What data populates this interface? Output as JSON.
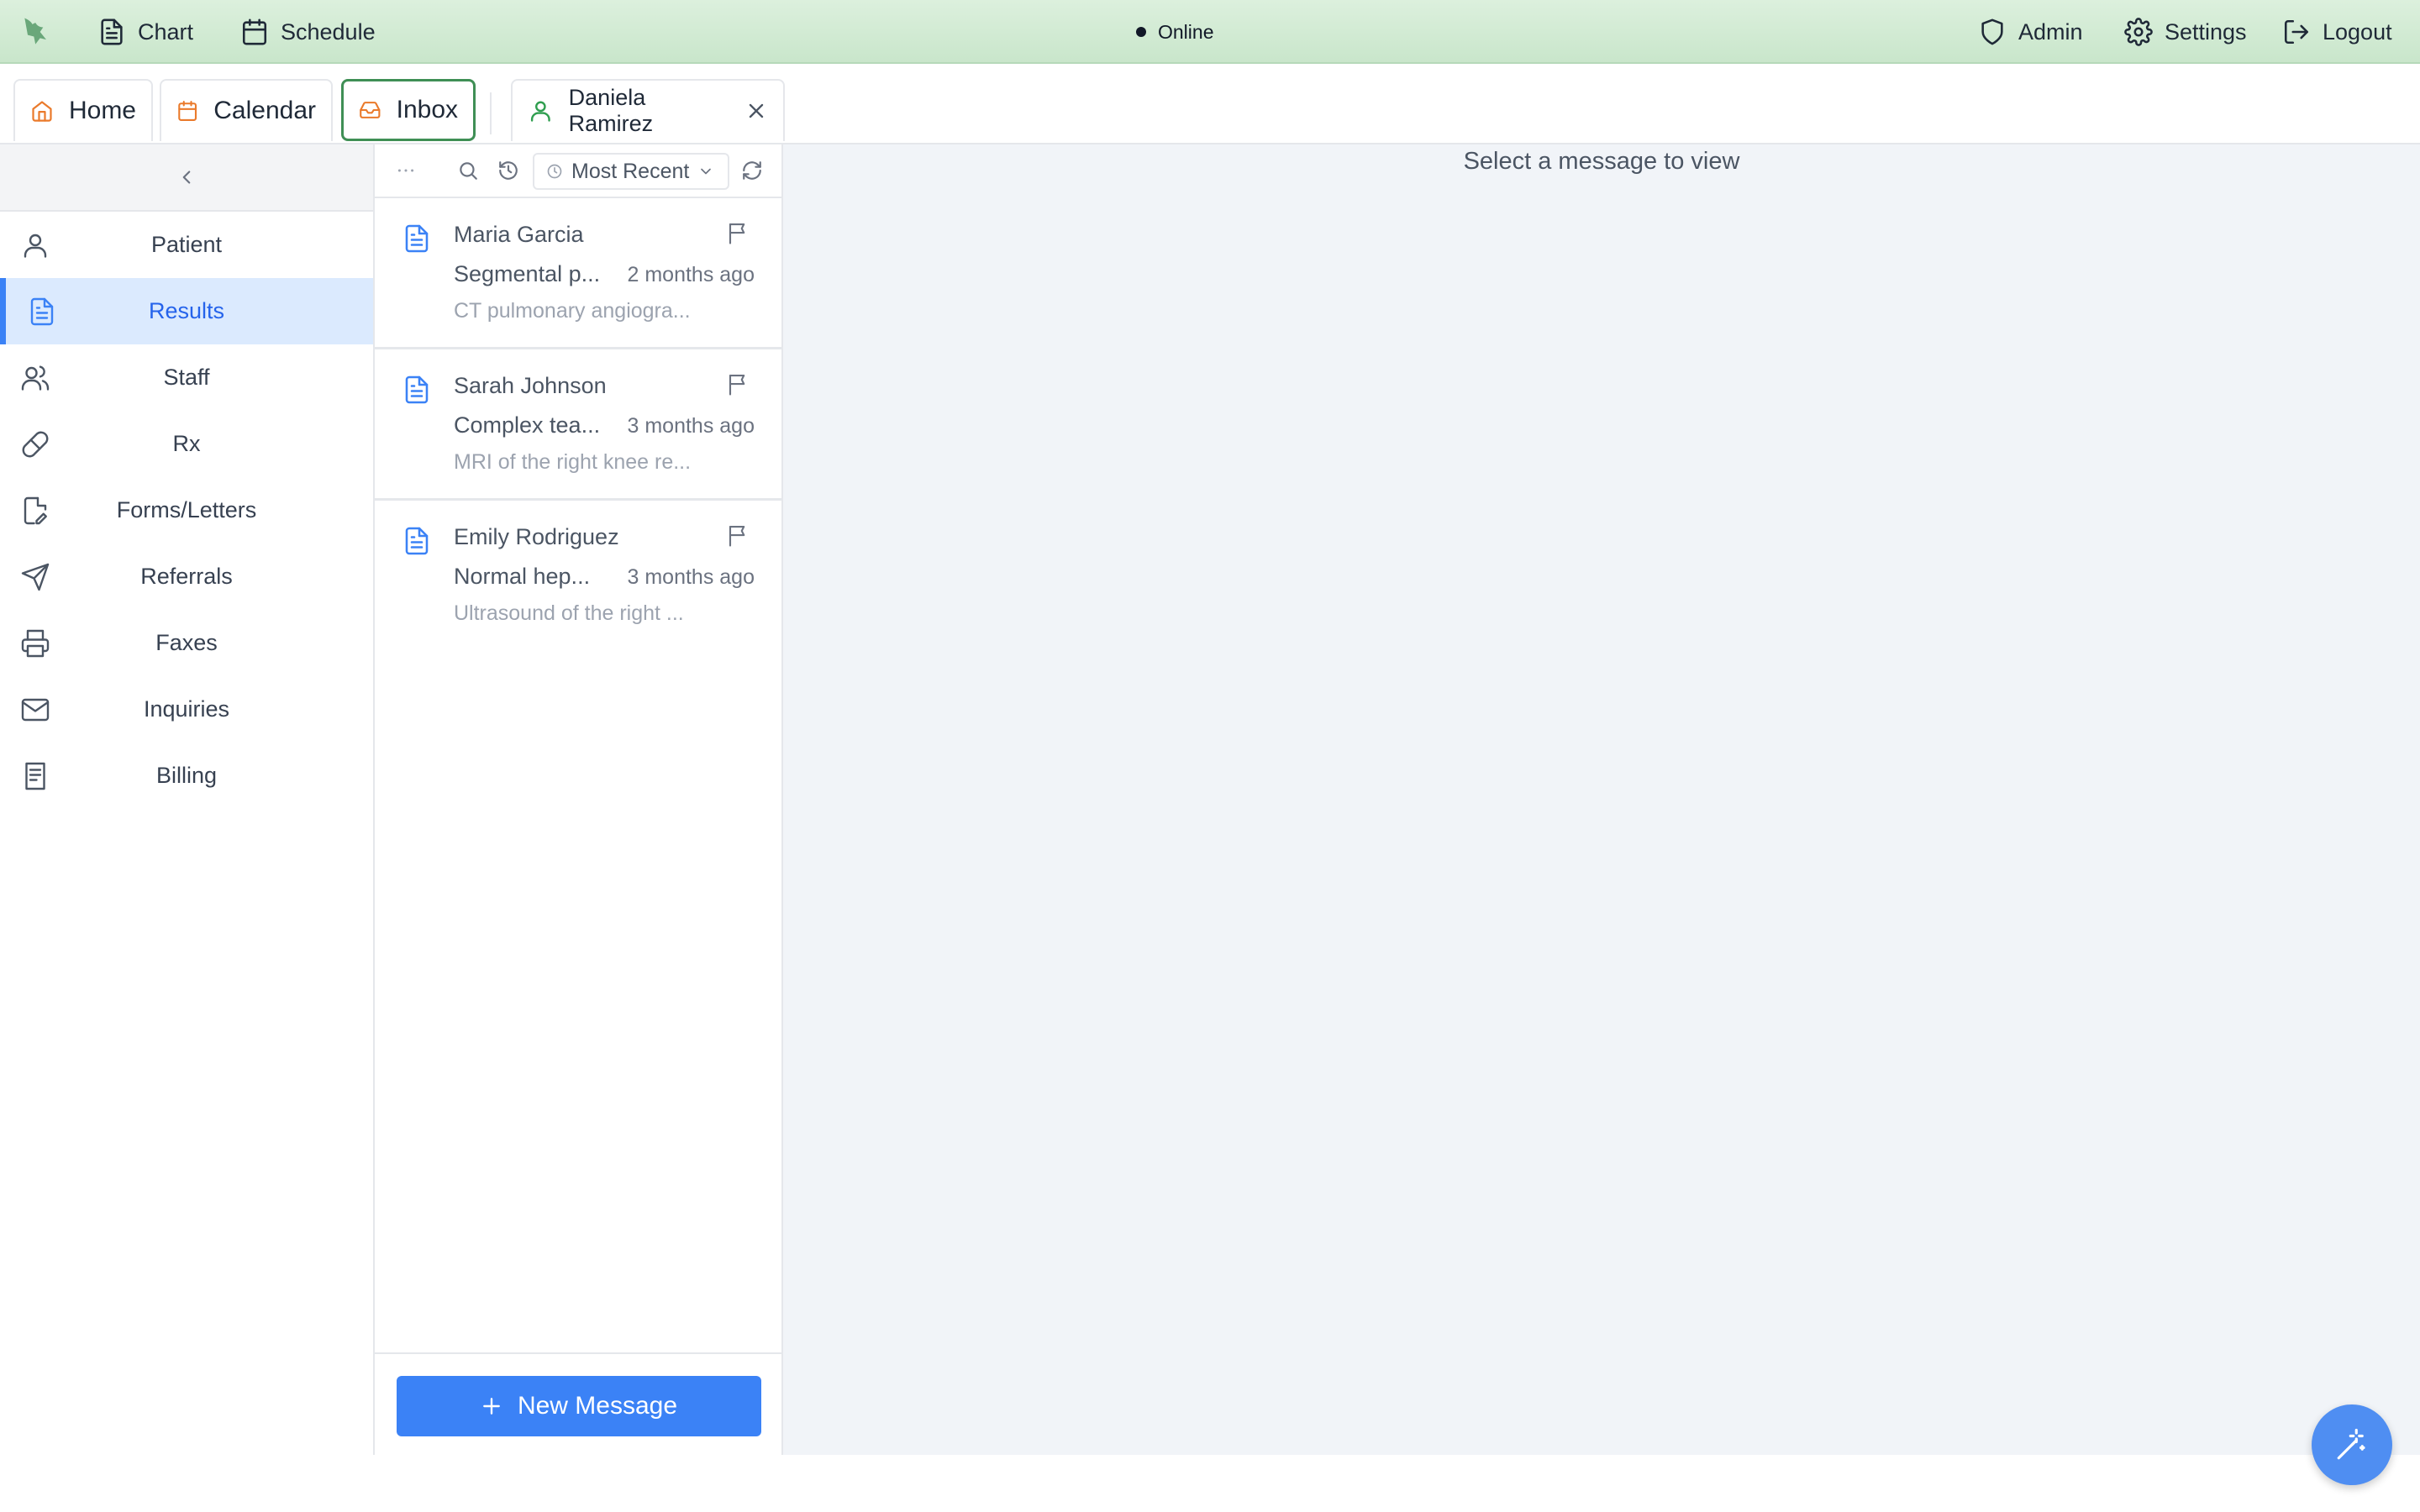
{
  "topbar": {
    "nav": [
      {
        "label": "Chart",
        "icon": "file-text-icon"
      },
      {
        "label": "Schedule",
        "icon": "calendar-icon"
      }
    ],
    "status": "Online",
    "right": [
      {
        "label": "Admin",
        "icon": "shield-icon"
      },
      {
        "label": "Settings",
        "icon": "gear-icon"
      },
      {
        "label": "Logout",
        "icon": "logout-icon"
      }
    ]
  },
  "tabs": [
    {
      "label": "Home",
      "icon": "home-icon",
      "active": false
    },
    {
      "label": "Calendar",
      "icon": "calendar-icon",
      "active": false
    },
    {
      "label": "Inbox",
      "icon": "inbox-icon",
      "active": true
    }
  ],
  "patient_tab": {
    "label": "Daniela Ramirez",
    "icon": "user-icon"
  },
  "sidebar": {
    "items": [
      {
        "label": "Patient",
        "icon": "user-icon",
        "active": false
      },
      {
        "label": "Results",
        "icon": "document-icon",
        "active": true
      },
      {
        "label": "Staff",
        "icon": "users-icon",
        "active": false
      },
      {
        "label": "Rx",
        "icon": "pill-icon",
        "active": false
      },
      {
        "label": "Forms/Letters",
        "icon": "edit-document-icon",
        "active": false
      },
      {
        "label": "Referrals",
        "icon": "send-icon",
        "active": false
      },
      {
        "label": "Faxes",
        "icon": "printer-icon",
        "active": false
      },
      {
        "label": "Inquiries",
        "icon": "mail-icon",
        "active": false
      },
      {
        "label": "Billing",
        "icon": "receipt-icon",
        "active": false
      }
    ]
  },
  "messages": {
    "sort_label": "Most Recent",
    "items": [
      {
        "sender": "Maria Garcia",
        "subject": "Segmental p...",
        "time": "2 months ago",
        "preview": "CT pulmonary angiogra..."
      },
      {
        "sender": "Sarah Johnson",
        "subject": "Complex tea...",
        "time": "3 months ago",
        "preview": "MRI of the right knee re..."
      },
      {
        "sender": "Emily Rodriguez",
        "subject": "Normal hep...",
        "time": "3 months ago",
        "preview": "Ultrasound of the right ..."
      }
    ],
    "new_message_label": "New Message"
  },
  "pane": {
    "placeholder": "Select a message to view"
  },
  "colors": {
    "accent": "#3b82f6",
    "topbar": "#c9e6cb",
    "active_tab_border": "#3f8f55",
    "tab_icon": "#ea7a2b"
  }
}
